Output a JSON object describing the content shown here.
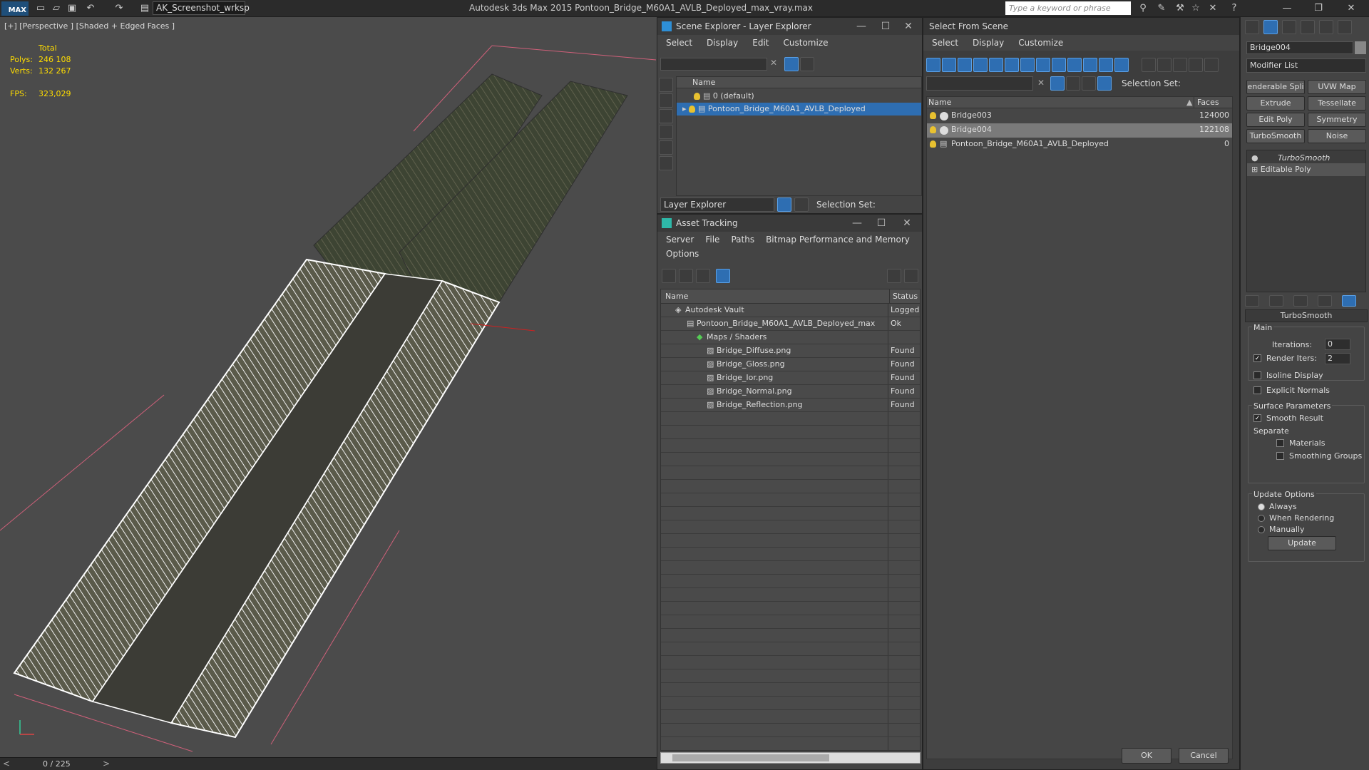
{
  "titlebar": {
    "logo": "MAX",
    "workspace": "AK_Screenshot_wrksp",
    "title": "Autodesk 3ds Max  2015    Pontoon_Bridge_M60A1_AVLB_Deployed_max_vray.max",
    "search_placeholder": "Type a keyword or phrase"
  },
  "viewport": {
    "label": "[+] [Perspective ] [Shaded + Edged Faces ]",
    "stats": {
      "total_label": "Total",
      "polys_label": "Polys:",
      "polys": "246 108",
      "verts_label": "Verts:",
      "verts": "132 267",
      "fps_label": "FPS:",
      "fps": "323,029"
    }
  },
  "timebar": {
    "value": "0 / 225"
  },
  "scene_explorer": {
    "title": "Scene Explorer - Layer Explorer",
    "menu": [
      "Select",
      "Display",
      "Edit",
      "Customize"
    ],
    "col_name": "Name",
    "rows": [
      "0 (default)",
      "Pontoon_Bridge_M60A1_AVLB_Deployed"
    ],
    "footer_explorer": "Layer Explorer",
    "footer_selset": "Selection Set:"
  },
  "asset_tracking": {
    "title": "Asset Tracking",
    "menu": [
      "Server",
      "File",
      "Paths",
      "Bitmap Performance and Memory"
    ],
    "menu2": "Options",
    "col_name": "Name",
    "col_status": "Status",
    "rows": [
      {
        "name": "Autodesk Vault",
        "status": "Logged Out"
      },
      {
        "name": "Pontoon_Bridge_M60A1_AVLB_Deployed_max...",
        "status": "Ok"
      },
      {
        "name": "Maps / Shaders",
        "status": ""
      },
      {
        "name": "Bridge_Diffuse.png",
        "status": "Found"
      },
      {
        "name": "Bridge_Gloss.png",
        "status": "Found"
      },
      {
        "name": "Bridge_Ior.png",
        "status": "Found"
      },
      {
        "name": "Bridge_Normal.png",
        "status": "Found"
      },
      {
        "name": "Bridge_Reflection.png",
        "status": "Found"
      }
    ]
  },
  "select_from_scene": {
    "title": "Select From Scene",
    "menu": [
      "Select",
      "Display",
      "Customize"
    ],
    "selset": "Selection Set:",
    "col_name": "Name",
    "col_faces": "Faces",
    "rows": [
      {
        "name": "Bridge003",
        "faces": "124000"
      },
      {
        "name": "Bridge004",
        "faces": "122108"
      },
      {
        "name": "Pontoon_Bridge_M60A1_AVLB_Deployed",
        "faces": "0"
      }
    ],
    "ok": "OK",
    "cancel": "Cancel"
  },
  "command_panel": {
    "object_name": "Bridge004",
    "modifier_list": "Modifier List",
    "buttons": [
      "enderable Spli",
      "UVW Map",
      "Extrude",
      "Tessellate",
      "Edit Poly",
      "Symmetry",
      "TurboSmooth",
      "Noise"
    ],
    "stack": [
      "TurboSmooth",
      "Editable Poly"
    ],
    "rollout_title": "TurboSmooth",
    "main_label": "Main",
    "iterations_label": "Iterations:",
    "iterations": "0",
    "render_iters_label": "Render Iters:",
    "render_iters": "2",
    "isoline": "Isoline Display",
    "explicit_normals": "Explicit Normals",
    "surface_params": "Surface Parameters",
    "smooth_result": "Smooth Result",
    "separate": "Separate",
    "materials": "Materials",
    "smoothing_groups": "Smoothing Groups",
    "update_options": "Update Options",
    "always": "Always",
    "when_rendering": "When Rendering",
    "manually": "Manually",
    "update": "Update"
  }
}
